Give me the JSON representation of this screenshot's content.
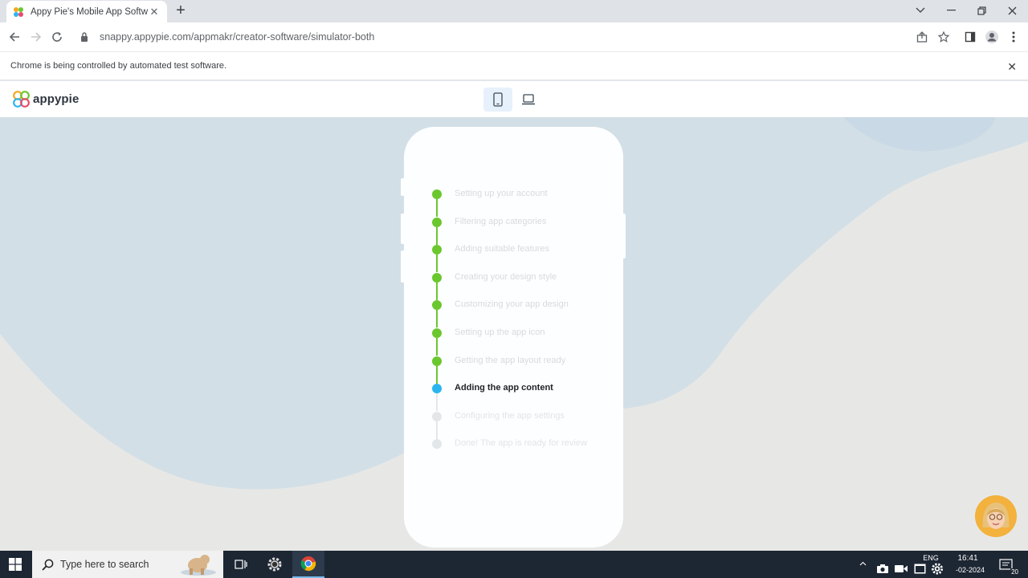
{
  "browser": {
    "tab_title": "Appy Pie's Mobile App Software",
    "tab_close": "✕",
    "new_tab": "+",
    "url": "snappy.appypie.com/appmakr/creator-software/simulator-both",
    "infobar_text": "Chrome is being controlled by automated test software.",
    "infobar_close": "✕"
  },
  "app": {
    "logo_text": "appypie",
    "device_toggle": [
      "mobile",
      "desktop"
    ],
    "active_device": "mobile"
  },
  "progress": {
    "steps": [
      {
        "label": "Setting up your account",
        "status": "done"
      },
      {
        "label": "Filtering app categories",
        "status": "done"
      },
      {
        "label": "Adding suitable features",
        "status": "done"
      },
      {
        "label": "Creating your design style",
        "status": "done"
      },
      {
        "label": "Customizing your app design",
        "status": "done"
      },
      {
        "label": "Setting up the app icon",
        "status": "done"
      },
      {
        "label": "Getting the app layout ready",
        "status": "done"
      },
      {
        "label": "Adding the app content",
        "status": "current"
      },
      {
        "label": "Configuring the app settings",
        "status": "pending"
      },
      {
        "label": "Done! The app is ready for review",
        "status": "pending"
      }
    ]
  },
  "taskbar": {
    "search_placeholder": "Type here to search",
    "lang": "ENG",
    "time": "16:41",
    "date": "-02-2024",
    "notification_count": "20"
  },
  "colors": {
    "done": "#6bc72e",
    "current": "#2bb5f0",
    "pending": "#e4e7ea",
    "blob": "#d3dfe6",
    "stage_bg": "#e7e8e6"
  }
}
